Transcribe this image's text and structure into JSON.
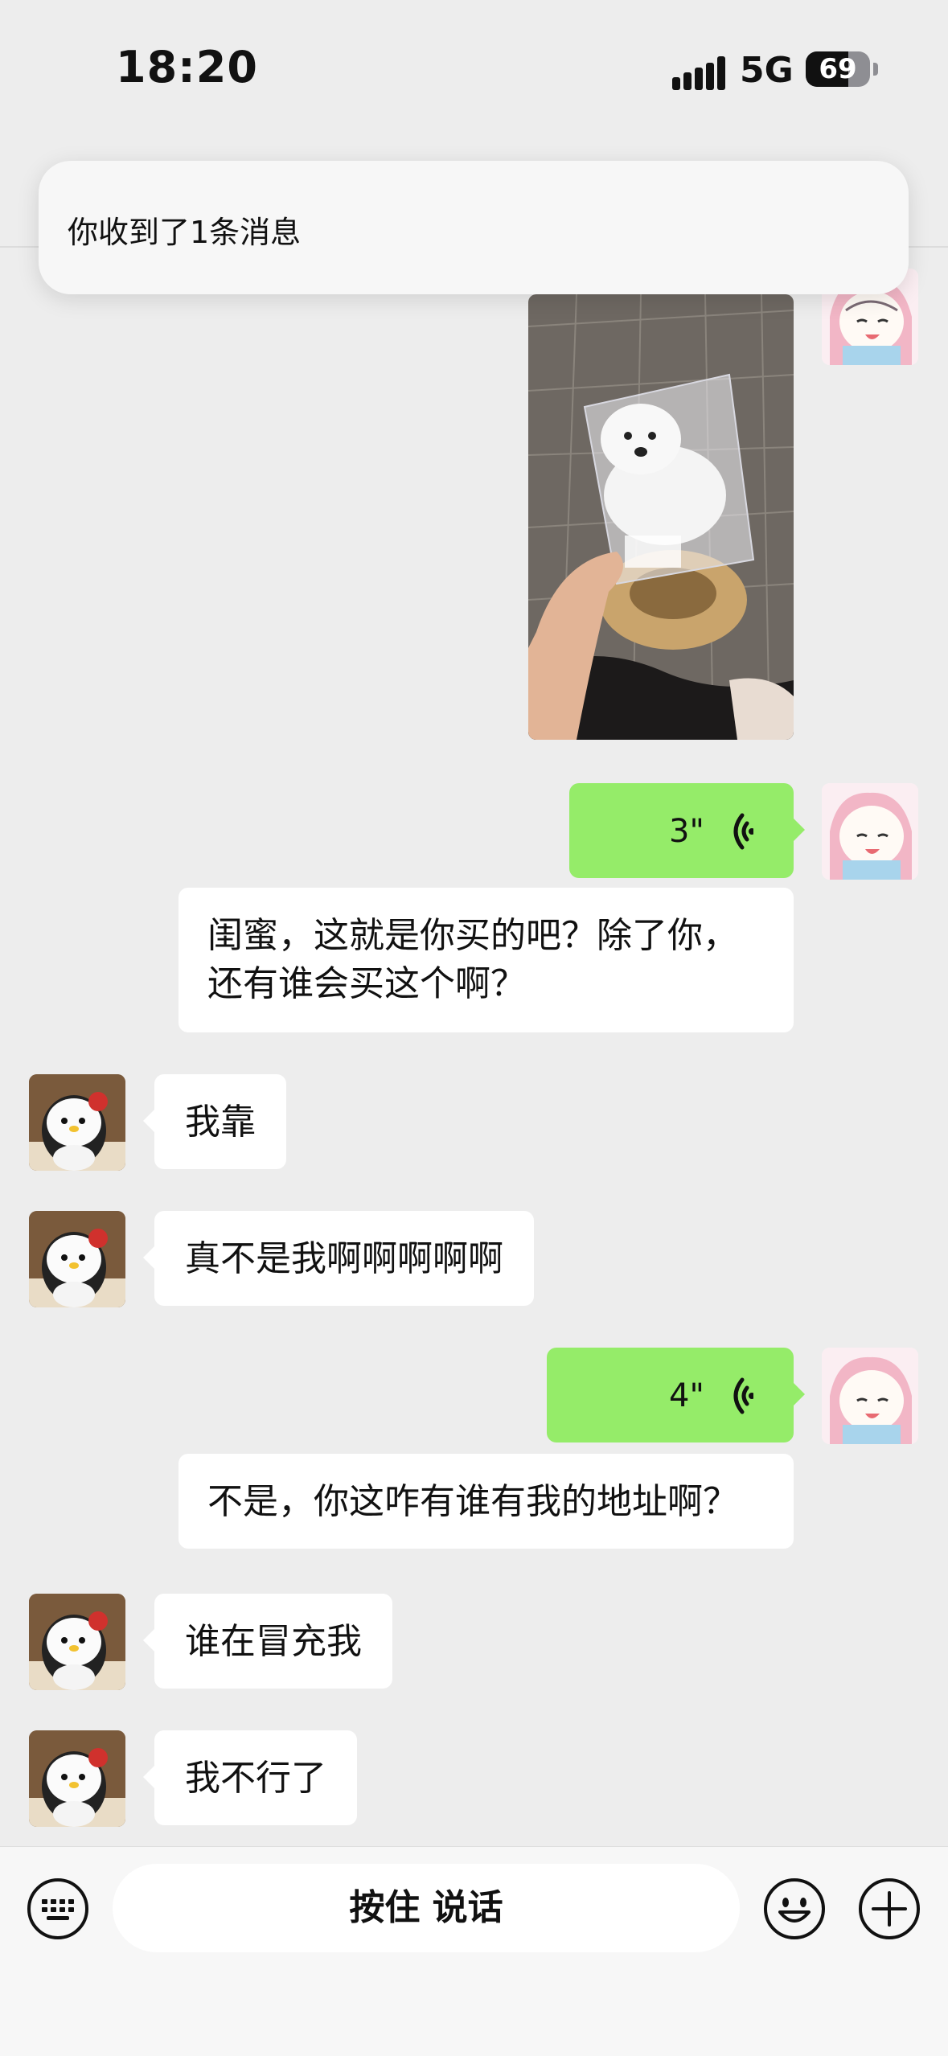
{
  "status_bar": {
    "time": "18:20",
    "network": "5G",
    "battery_level": "69"
  },
  "notification": {
    "text": "你收到了1条消息"
  },
  "messages": [
    {
      "side": "out",
      "type": "image",
      "description_icon": "photo-thumbnail"
    },
    {
      "side": "out",
      "type": "voice",
      "duration": "3\""
    },
    {
      "side": "in-right",
      "type": "text",
      "text": "闺蜜，这就是你买的吧？除了你，\n还有谁会买这个啊？"
    },
    {
      "side": "in",
      "type": "text",
      "text": "我靠"
    },
    {
      "side": "in",
      "type": "text",
      "text": "真不是我啊啊啊啊啊"
    },
    {
      "side": "out",
      "type": "voice",
      "duration": "4\""
    },
    {
      "side": "in-right",
      "type": "text",
      "text": "不是，你这咋有谁有我的地址啊？"
    },
    {
      "side": "in",
      "type": "text",
      "text": "谁在冒充我"
    },
    {
      "side": "in",
      "type": "text",
      "text": "我不行了"
    }
  ],
  "input_bar": {
    "hold_to_talk_label": "按住 说话"
  },
  "colors": {
    "background": "#ededed",
    "out_bubble": "#95ec69",
    "in_bubble": "#ffffff"
  }
}
